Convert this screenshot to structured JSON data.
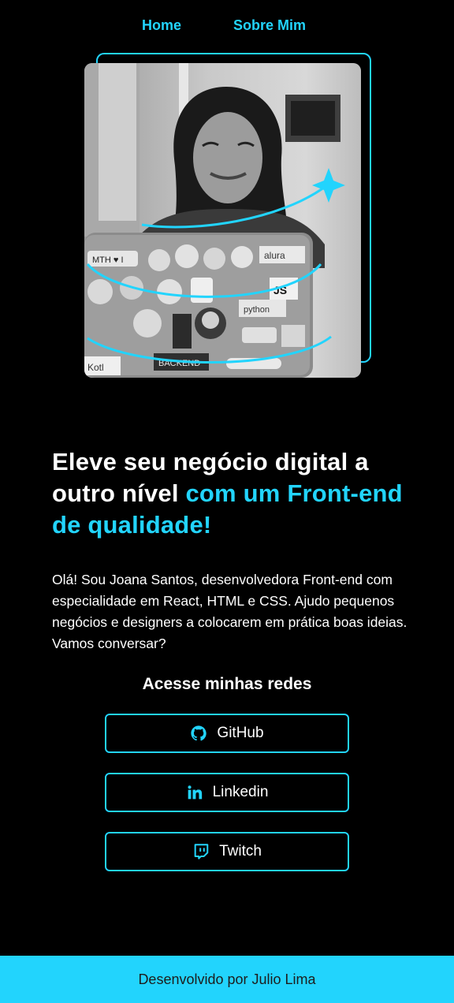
{
  "nav": {
    "home": "Home",
    "about": "Sobre Mim"
  },
  "hero": {
    "headline_white": "Eleve seu negócio digital a outro nível",
    "headline_accent": "com um Front-end de qualidade!",
    "intro": "Olá! Sou Joana Santos, desenvolvedora Front-end com especialidade em React, HTML e CSS. Ajudo pequenos negócios e designers a colocarem em prática boas ideias. Vamos conversar?",
    "image_alt": "Joana Santos sorrindo atrás de um notebook cheio de adesivos",
    "sticker_texts": [
      "MTH ♥ I",
      "alura",
      "JS",
      "python",
      "BACKEND",
      "Kotl"
    ]
  },
  "social": {
    "title": "Acesse minhas redes",
    "buttons": [
      {
        "label": "GitHub",
        "icon": "github-icon"
      },
      {
        "label": "Linkedin",
        "icon": "linkedin-icon"
      },
      {
        "label": "Twitch",
        "icon": "twitch-icon"
      }
    ]
  },
  "footer": {
    "text": "Desenvolvido por Julio Lima"
  },
  "colors": {
    "background": "#000000",
    "accent": "#22d4fd",
    "text": "#ffffff",
    "footer_text": "#1d1d1d"
  }
}
